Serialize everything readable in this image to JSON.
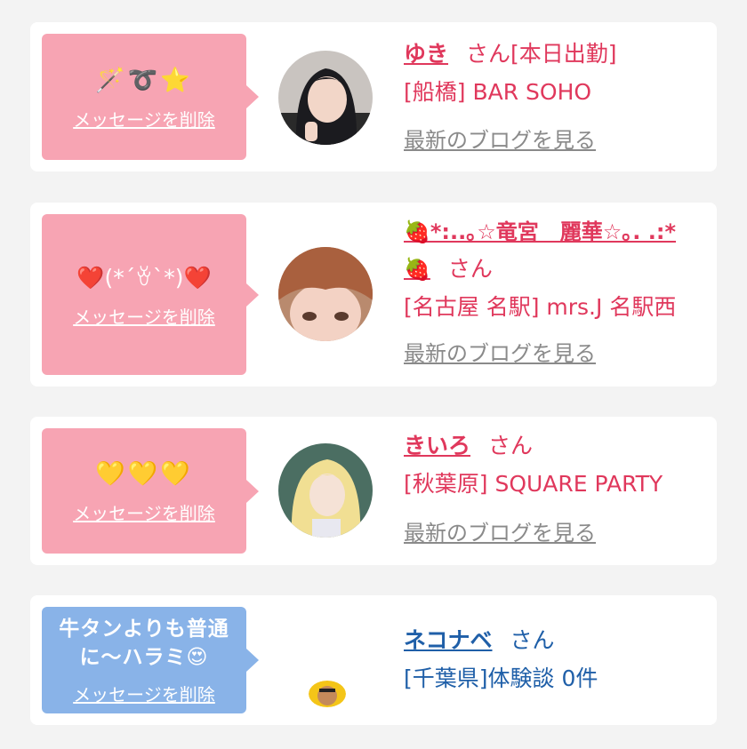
{
  "cards": [
    {
      "message": "🪄➰⭐",
      "delete_label": "メッセージを削除",
      "name": "ゆき",
      "san": "さん",
      "status": "[本日出勤]",
      "shop": "[船橋] BAR SOHO",
      "blog_label": "最新のブログを見る"
    },
    {
      "message": "❤️(*´ꈊ`*)❤️",
      "delete_label": "メッセージを削除",
      "name": "🍓*:..｡☆竜宮　麗華☆｡. .:*🍓",
      "san": "さん",
      "shop": "[名古屋 名駅] mrs.J 名駅西",
      "blog_label": "最新のブログを見る"
    },
    {
      "message": "💛💛💛",
      "delete_label": "メッセージを削除",
      "name": "きいろ",
      "san": "さん",
      "shop": "[秋葉原] SQUARE PARTY",
      "blog_label": "最新のブログを見る"
    },
    {
      "message": "牛タンよりも普通に〜ハラミ😍",
      "message_line1": "牛タンよりも普通",
      "message_line2": "に〜ハラミ😍",
      "delete_label": "メッセージを削除",
      "name": "ネコナベ",
      "san": "さん",
      "shop": "[千葉県]体験談 0件"
    }
  ],
  "colors": {
    "pink_bubble": "#f7a4b3",
    "blue_bubble": "#89b3e8",
    "pink_text": "#e0385c",
    "blue_text": "#1f5fa8",
    "link_gray": "#8a8a8a"
  }
}
